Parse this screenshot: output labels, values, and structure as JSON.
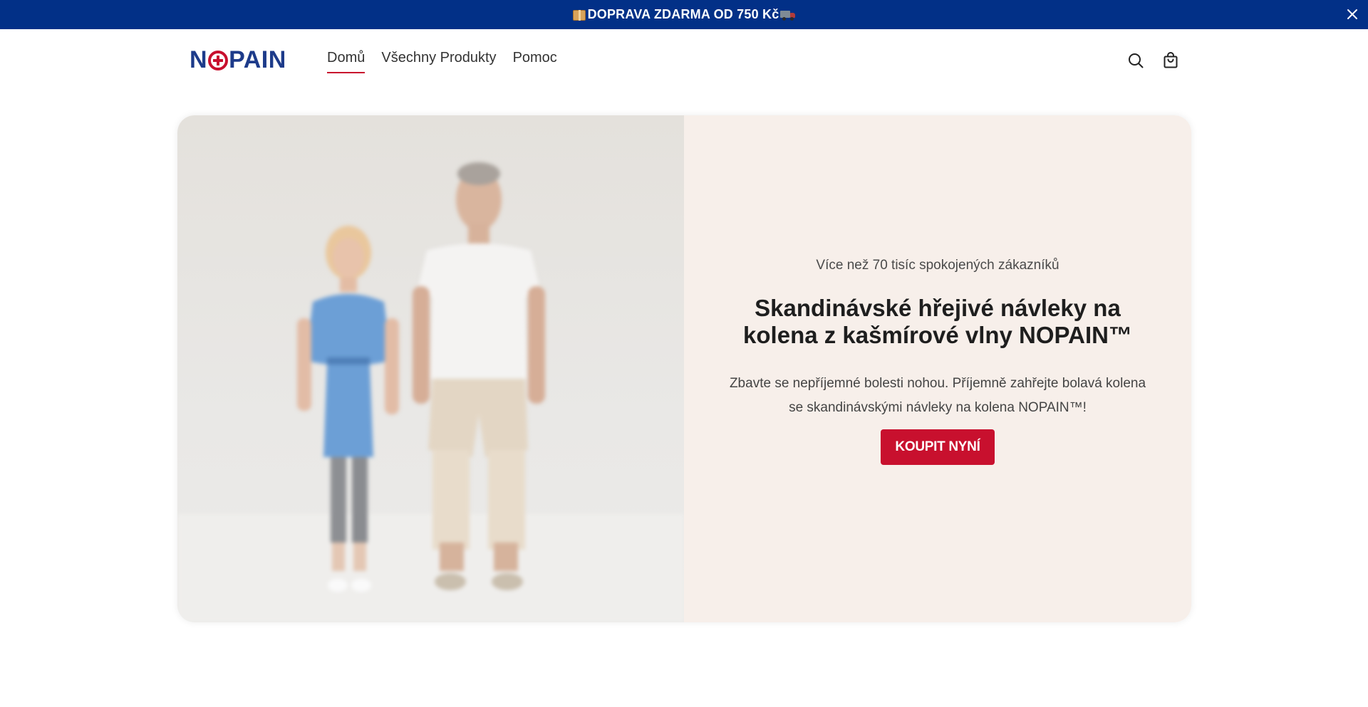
{
  "announcement": {
    "text": "DOPRAVA ZDARMA OD 750 Kč",
    "leading_icon": "package-icon",
    "trailing_icon": "truck-icon",
    "background": "#023087",
    "close_icon": "close-icon"
  },
  "header": {
    "logo": "NOPAIN",
    "nav": [
      {
        "label": "Domů",
        "active": true
      },
      {
        "label": "Všechny Produkty",
        "active": false
      },
      {
        "label": "Pomoc",
        "active": false
      }
    ],
    "icons": [
      "search-icon",
      "cart-icon"
    ]
  },
  "hero": {
    "kicker": "Více než 70 tisíc spokojených zákazníků",
    "title": "Skandinávské hřejivé návleky na kolena z kašmírové vlny NOPAIN™",
    "description": "Zbavte se nepříjemné bolesti nohou. Příjemně zahřejte bolavá kolena se skandinávskými návleky na kolena NOPAIN™!",
    "cta_label": "KOUPIT NYNÍ",
    "panel_background": "#f7efea"
  },
  "colors": {
    "brand_blue": "#1d3b8a",
    "brand_red": "#c8102e"
  }
}
